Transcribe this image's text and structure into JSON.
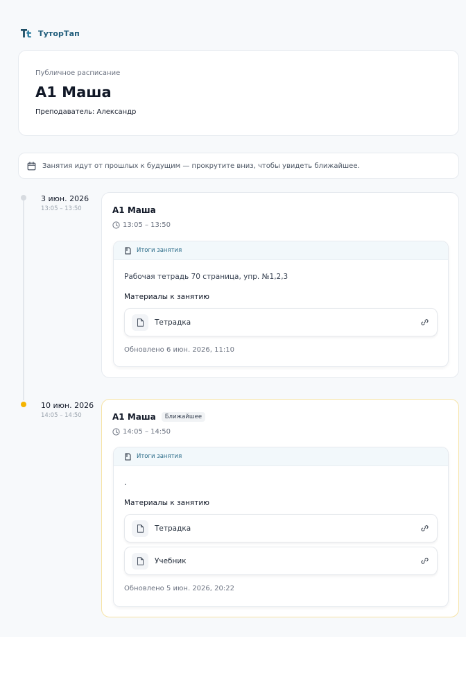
{
  "brand": {
    "name": "ТуторТап"
  },
  "header": {
    "kicker": "Публичное расписание",
    "title": "A1 Маша",
    "teacher": "Преподаватель: Александр"
  },
  "notice": {
    "text": "Занятия идут от прошлых к будущим — прокрутите вниз, чтобы увидеть ближайшее."
  },
  "lessons": [
    {
      "date": "3 июн. 2026",
      "time": "13:05 – 13:50",
      "title": "A1 Маша",
      "badge": "",
      "summary_label": "Итоги занятия",
      "summary_text": "Рабочая тетрадь 70 страница, упр. №1,2,3",
      "materials_label": "Материалы к занятию",
      "files": [
        "Тетрадка"
      ],
      "updated": "Обновлено 6 июн. 2026, 11:10"
    },
    {
      "date": "10 июн. 2026",
      "time": "14:05 – 14:50",
      "title": "A1 Маша",
      "badge": "Ближайшее",
      "summary_label": "Итоги занятия",
      "summary_text": ".",
      "materials_label": "Материалы к занятию",
      "files": [
        "Тетрадка",
        "Учебник"
      ],
      "updated": "Обновлено 5 июн. 2026, 20:22"
    }
  ],
  "colors": {
    "accent": "#1f5c7a",
    "next_dot": "#f5b400",
    "next_border": "#f6e3a6"
  }
}
